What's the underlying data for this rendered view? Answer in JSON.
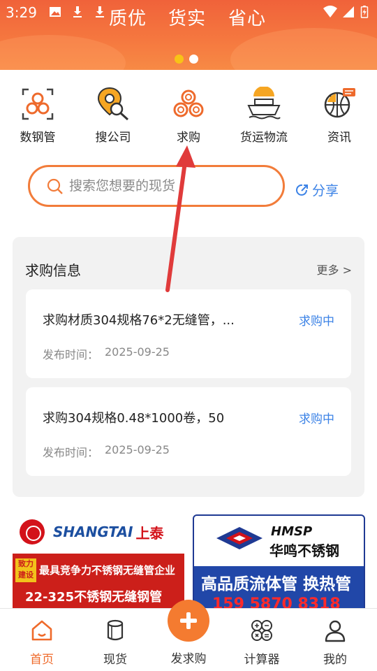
{
  "status_bar": {
    "time": "3:29"
  },
  "banner": {
    "slogans": [
      "质优",
      "货实",
      "省心"
    ],
    "carousel_count": 2,
    "carousel_active": 1
  },
  "quick_nav": [
    {
      "label": "数钢管",
      "icon": "pipes-count-icon"
    },
    {
      "label": "搜公司",
      "icon": "location-search-icon"
    },
    {
      "label": "求购",
      "icon": "pipes-icon"
    },
    {
      "label": "货运物流",
      "icon": "ship-icon"
    },
    {
      "label": "资讯",
      "icon": "globe-news-icon"
    }
  ],
  "search": {
    "placeholder": "搜索您想要的现货"
  },
  "share": {
    "label": "分享"
  },
  "purchase": {
    "title": "求购信息",
    "more": "更多 >",
    "items": [
      {
        "title": "求购材质304规格76*2无缝管，...",
        "status": "求购中",
        "time_label": "发布时间：",
        "time": "2025-09-25"
      },
      {
        "title": "求购304规格0.48*1000卷，50",
        "status": "求购中",
        "time_label": "发布时间：",
        "time": "2025-09-25"
      }
    ]
  },
  "ads": {
    "left": {
      "brand": "SHANGTAI",
      "brand_cn": "上泰",
      "badge": "致力建设",
      "line1": "最具竞争力不锈钢无缝管企业",
      "line2": "22-325不锈钢无缝钢管"
    },
    "right": {
      "brand": "HMSP",
      "brand_cn": "华鸣不锈钢",
      "slogan": "高品质流体管 换热管",
      "phone": "159 5870 8318"
    }
  },
  "tabbar": {
    "tabs": [
      {
        "label": "首页",
        "icon": "home-icon",
        "active": true
      },
      {
        "label": "现货",
        "icon": "stock-cylinder-icon",
        "active": false
      },
      {
        "label": "发求购",
        "icon": "plus-icon",
        "active": false
      },
      {
        "label": "计算器",
        "icon": "calculator-icon",
        "active": false
      },
      {
        "label": "我的",
        "icon": "user-icon",
        "active": false
      }
    ]
  },
  "colors": {
    "accent": "#f47b30",
    "link": "#3b82e6",
    "annotation": "#e03b3b"
  }
}
